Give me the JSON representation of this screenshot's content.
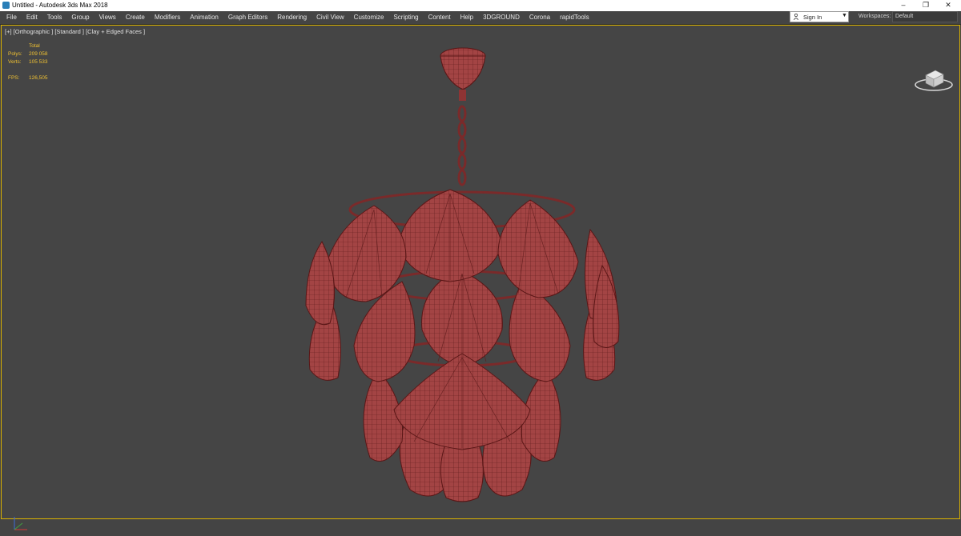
{
  "titlebar": {
    "title": "Untitled - Autodesk 3ds Max 2018",
    "min": "–",
    "restore": "❐",
    "close": "✕"
  },
  "menu": [
    "File",
    "Edit",
    "Tools",
    "Group",
    "Views",
    "Create",
    "Modifiers",
    "Animation",
    "Graph Editors",
    "Rendering",
    "Civil View",
    "Customize",
    "Scripting",
    "Content",
    "Help",
    "3DGROUND",
    "Corona",
    "rapidTools"
  ],
  "account": {
    "sign_in": "Sign In"
  },
  "workspaces": {
    "label": "Workspaces:",
    "value": "Default"
  },
  "viewport": {
    "label": "[+] [Orthographic ] [Standard ] [Clay + Edged Faces ]",
    "stats": {
      "header": "Total",
      "polys_label": "Polys:",
      "polys_value": "209 058",
      "verts_label": "Verts:",
      "verts_value": "105 533",
      "fps_label": "FPS:",
      "fps_value": "126,505"
    }
  },
  "colors": {
    "viewport_bg": "#454545",
    "active_border": "#d9b200",
    "stats_text": "#f1c232",
    "mesh_fill": "#9e3d3d",
    "mesh_wire": "#5a1616"
  }
}
